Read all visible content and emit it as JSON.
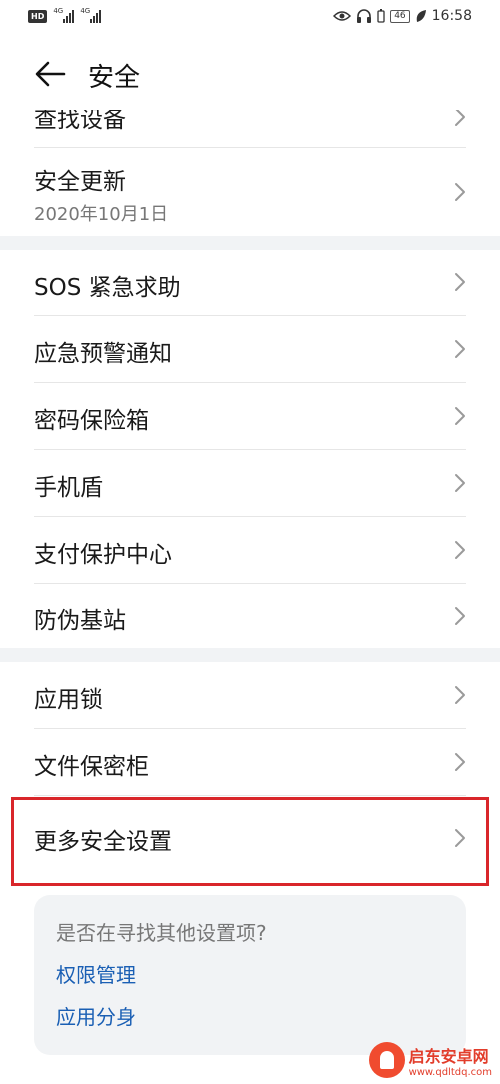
{
  "status_bar": {
    "left_badge": "HD",
    "net1": "4G",
    "net2": "4G",
    "battery": "46",
    "time": "16:58"
  },
  "header": {
    "title": "安全"
  },
  "items": [
    {
      "label": "查找设备"
    },
    {
      "label": "安全更新",
      "sub": "2020年10月1日"
    },
    {
      "label": "SOS 紧急求助"
    },
    {
      "label": "应急预警通知"
    },
    {
      "label": "密码保险箱"
    },
    {
      "label": "手机盾"
    },
    {
      "label": "支付保护中心"
    },
    {
      "label": "防伪基站"
    },
    {
      "label": "应用锁"
    },
    {
      "label": "文件保密柜"
    },
    {
      "label": "更多安全设置"
    }
  ],
  "hint": {
    "question": "是否在寻找其他设置项?",
    "links": [
      "权限管理",
      "应用分身"
    ]
  },
  "watermark": {
    "name": "启东安卓网",
    "url": "www.qdltdq.com"
  },
  "colors": {
    "highlight": "#d9262a",
    "link": "#1a5fb4",
    "section_gap": "#f1f3f5"
  }
}
